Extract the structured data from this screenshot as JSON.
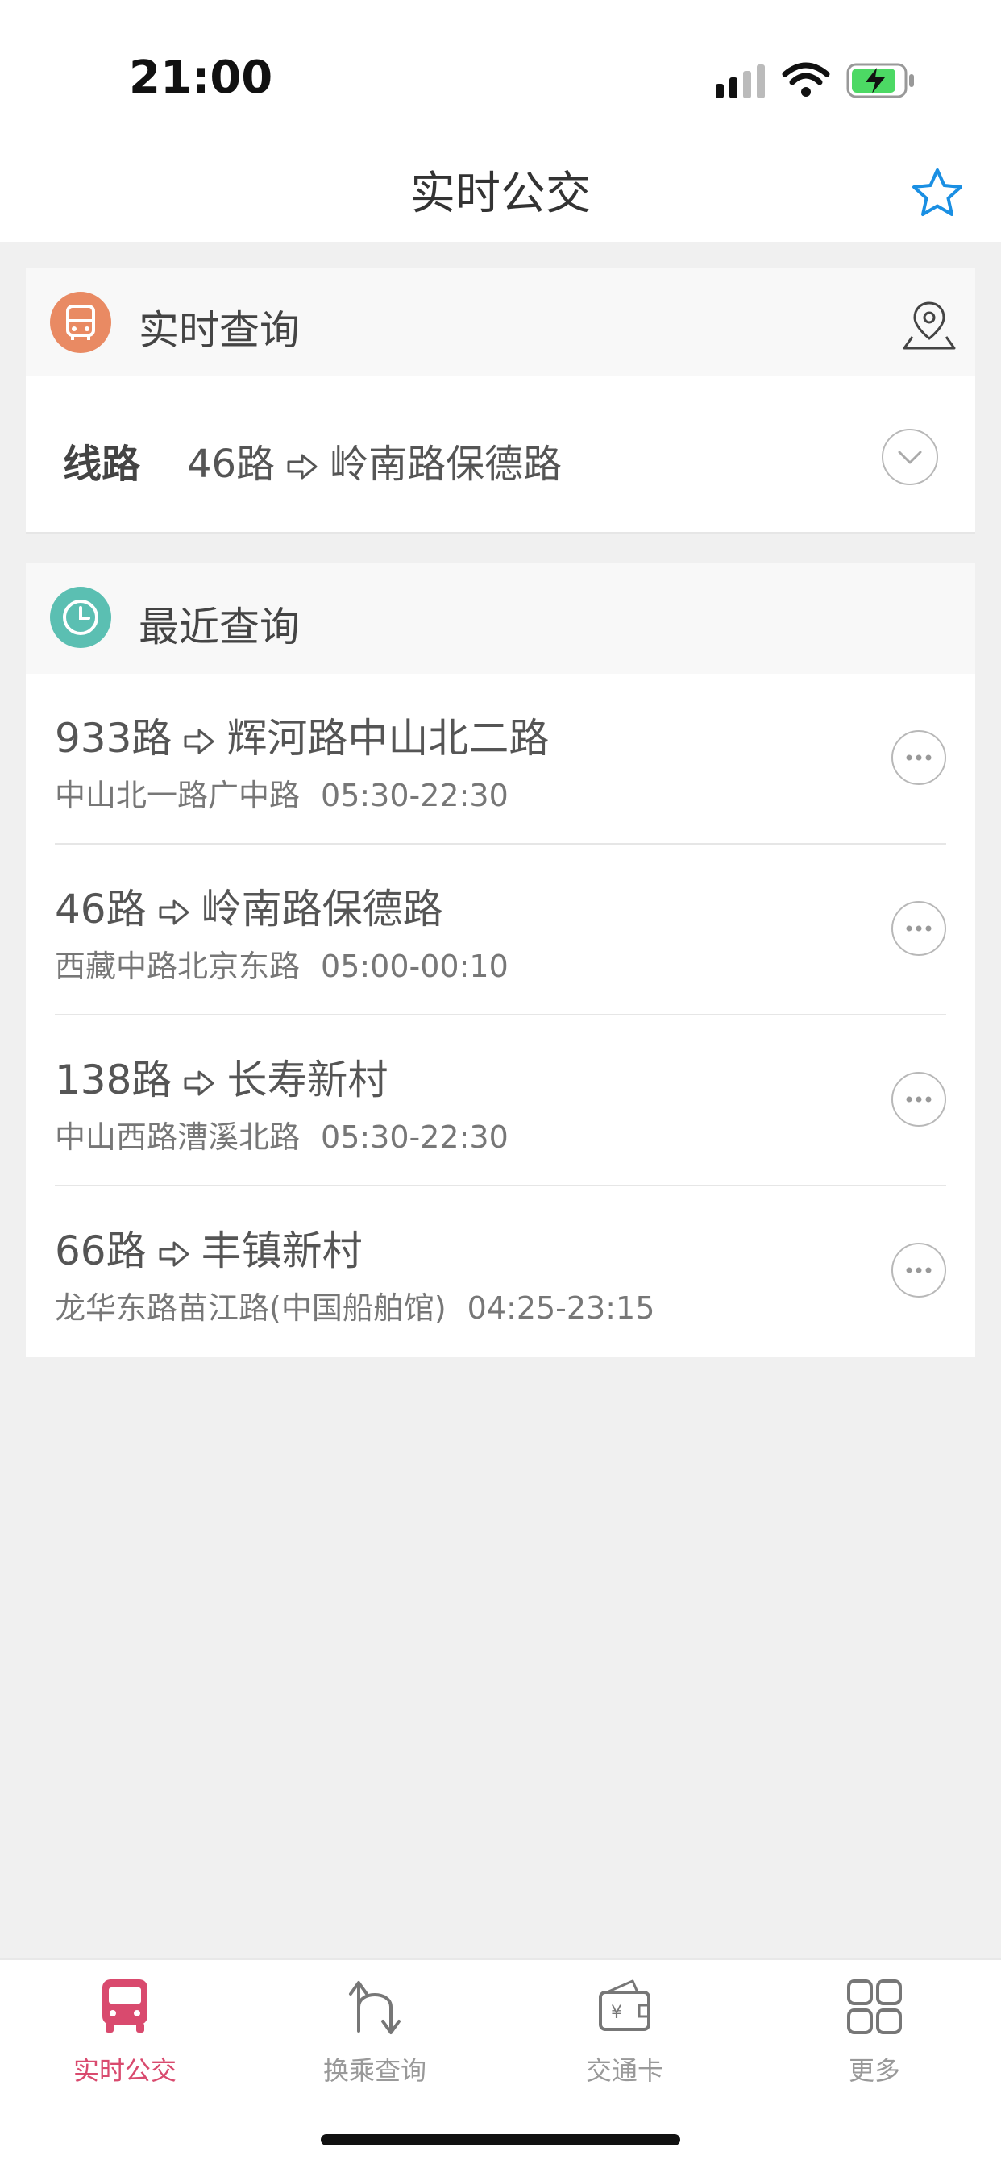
{
  "status_bar": {
    "time": "21:00"
  },
  "header": {
    "title": "实时公交"
  },
  "realtime": {
    "section_title": "实时查询",
    "line_label": "线路",
    "route": "46路",
    "destination": "岭南路保德路"
  },
  "recent": {
    "section_title": "最近查询",
    "items": [
      {
        "route": "933路",
        "destination": "辉河路中山北二路",
        "stop": "中山北一路广中路",
        "hours": "05:30-22:30"
      },
      {
        "route": "46路",
        "destination": "岭南路保德路",
        "stop": "西藏中路北京东路",
        "hours": "05:00-00:10"
      },
      {
        "route": "138路",
        "destination": "长寿新村",
        "stop": "中山西路漕溪北路",
        "hours": "05:30-22:30"
      },
      {
        "route": "66路",
        "destination": "丰镇新村",
        "stop": "龙华东路苗江路(中国船舶馆)",
        "hours": "04:25-23:15"
      }
    ]
  },
  "tabs": [
    {
      "label": "实时公交",
      "icon": "bus-icon",
      "active": true
    },
    {
      "label": "换乘查询",
      "icon": "transfer-icon",
      "active": false
    },
    {
      "label": "交通卡",
      "icon": "card-wallet-icon",
      "active": false
    },
    {
      "label": "更多",
      "icon": "grid-icon",
      "active": false
    }
  ],
  "colors": {
    "accent": "#d94a6e",
    "realtime_icon": "#e98a63",
    "recent_icon": "#5bbfb2",
    "star": "#1a8fe3"
  }
}
